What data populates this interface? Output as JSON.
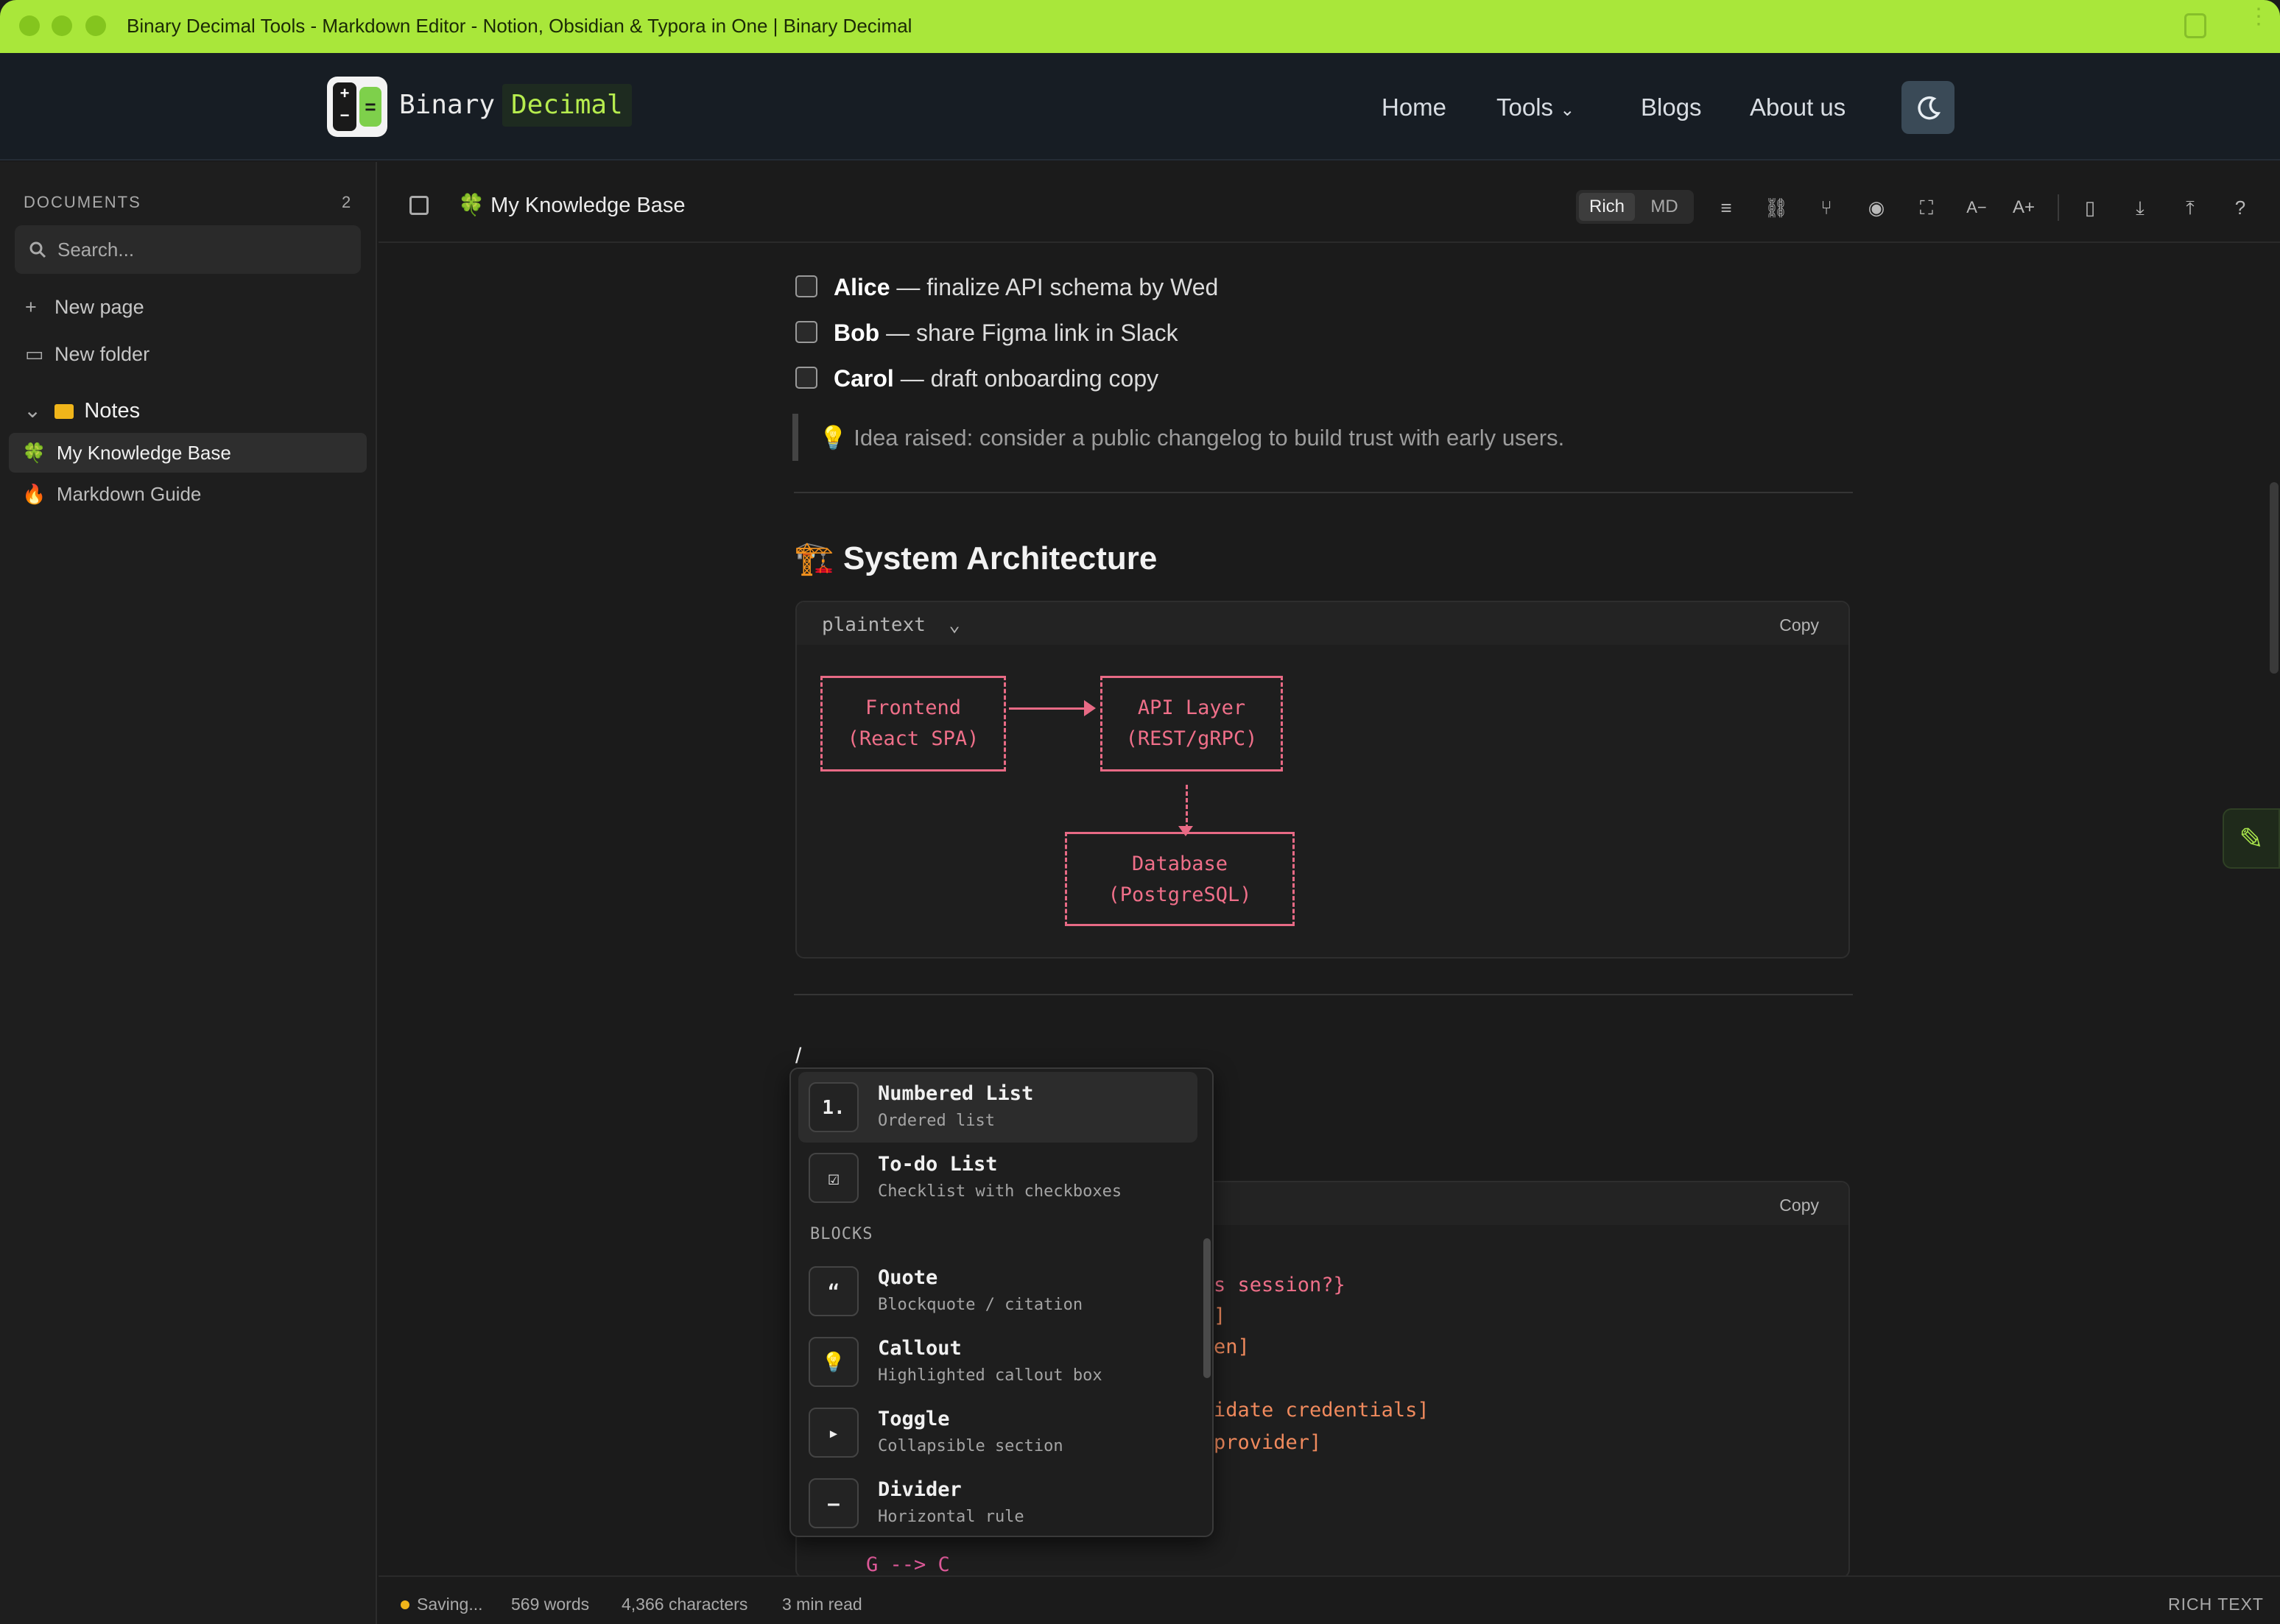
{
  "window": {
    "title": "Binary Decimal Tools - Markdown Editor - Notion, Obsidian & Typora in One | Binary Decimal",
    "accent": "#a9e73a"
  },
  "header": {
    "brand_part1": "Binary",
    "brand_part2": "Decimal",
    "nav": [
      "Home",
      "Tools",
      "Blogs",
      "About us"
    ],
    "theme_icon": "moon-icon"
  },
  "sidebar": {
    "section_label": "DOCUMENTS",
    "doc_count": "2",
    "search_placeholder": "Search...",
    "actions": [
      "New page",
      "New folder"
    ],
    "folder": "Notes",
    "documents": [
      {
        "icon": "🍀",
        "label": "My Knowledge Base",
        "selected": true
      },
      {
        "icon": "🔥",
        "label": "Markdown Guide",
        "selected": false
      }
    ]
  },
  "toolbar": {
    "doc_icon": "🍀",
    "doc_title": "My Knowledge Base",
    "mode_rich": "Rich",
    "mode_md": "MD",
    "font_smaller": "A−",
    "font_larger": "A+"
  },
  "content": {
    "todos": [
      {
        "name": "Alice",
        "text": " — finalize API schema by Wed"
      },
      {
        "name": "Bob",
        "text": " — share Figma link in Slack"
      },
      {
        "name": "Carol",
        "text": " — draft onboarding copy"
      }
    ],
    "quote": "💡 Idea raised: consider a public changelog to build trust with early users.",
    "heading": "🏗️ System Architecture",
    "code_block": {
      "language": "plaintext",
      "copy_label": "Copy",
      "boxes": [
        {
          "line1": "Frontend",
          "line2": "(React SPA)"
        },
        {
          "line1": "API Layer",
          "line2": "(REST/gRPC)"
        },
        {
          "line1": "Database",
          "line2": "(PostgreSQL)"
        }
      ]
    },
    "slash_char": "/",
    "second_code": {
      "copy_label": "Copy",
      "lines": [
        "s session?}",
        "]",
        "en]",
        "idate credentials]",
        "provider]",
        "G --> C"
      ]
    }
  },
  "slash_menu": {
    "items_top": [
      {
        "icon": "1.",
        "title": "Numbered List",
        "subtitle": "Ordered list"
      },
      {
        "icon": "☑",
        "title": "To-do List",
        "subtitle": "Checklist with checkboxes"
      }
    ],
    "section": "BLOCKS",
    "items_blocks": [
      {
        "icon": "“",
        "title": "Quote",
        "subtitle": "Blockquote / citation"
      },
      {
        "icon": "💡",
        "title": "Callout",
        "subtitle": "Highlighted callout box"
      },
      {
        "icon": "▸",
        "title": "Toggle",
        "subtitle": "Collapsible section"
      },
      {
        "icon": "—",
        "title": "Divider",
        "subtitle": "Horizontal rule"
      }
    ]
  },
  "status": {
    "saving": "Saving...",
    "words": "569 words",
    "chars": "4,366 characters",
    "read": "3 min read",
    "mode": "RICH TEXT"
  }
}
